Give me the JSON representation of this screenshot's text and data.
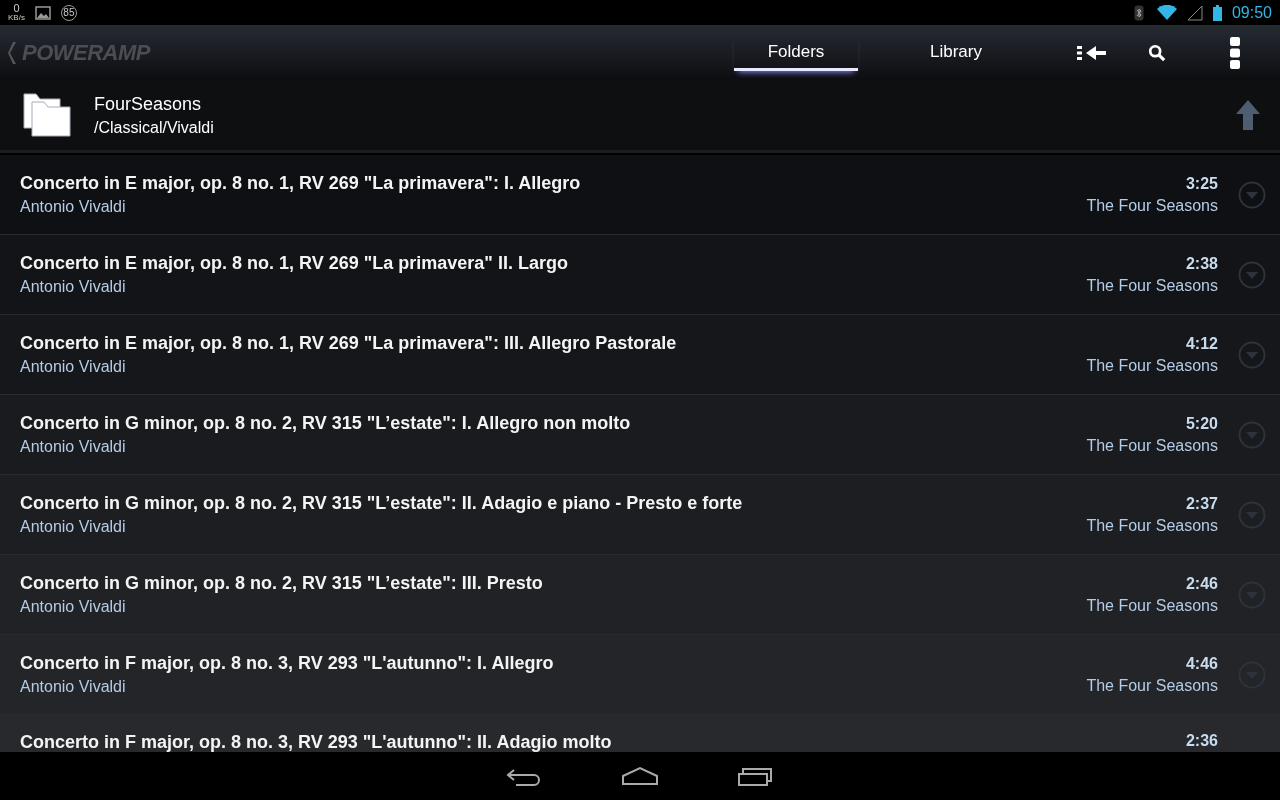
{
  "status_bar": {
    "net_speed": "0",
    "net_unit": "KB/s",
    "badge": "85",
    "time": "09:50"
  },
  "action_bar": {
    "logo": "POWERAMP",
    "tabs": [
      {
        "label": "Folders",
        "selected": true
      },
      {
        "label": "Library",
        "selected": false
      }
    ]
  },
  "folder": {
    "name": "FourSeasons",
    "path": "/Classical/Vivaldi"
  },
  "tracks": [
    {
      "title": "Concerto in E major, op. 8 no. 1, RV 269 \"La primavera\": I. Allegro",
      "artist": "Antonio Vivaldi",
      "duration": "3:25",
      "album": "The Four Seasons"
    },
    {
      "title": "Concerto in E major, op. 8 no. 1, RV 269 \"La primavera\" II. Largo",
      "artist": "Antonio Vivaldi",
      "duration": "2:38",
      "album": "The Four Seasons"
    },
    {
      "title": "Concerto in E major, op. 8 no. 1, RV 269 \"La primavera\": III. Allegro Pastorale",
      "artist": "Antonio Vivaldi",
      "duration": "4:12",
      "album": "The Four Seasons"
    },
    {
      "title": "Concerto in G minor, op. 8 no. 2, RV 315 \"L’estate\": I. Allegro non molto",
      "artist": "Antonio Vivaldi",
      "duration": "5:20",
      "album": "The Four Seasons"
    },
    {
      "title": "Concerto in G minor, op. 8 no. 2, RV 315 \"L’estate\": II. Adagio e piano - Presto e forte",
      "artist": "Antonio Vivaldi",
      "duration": "2:37",
      "album": "The Four Seasons"
    },
    {
      "title": "Concerto in G minor, op. 8 no. 2, RV 315 \"L’estate\": III. Presto",
      "artist": "Antonio Vivaldi",
      "duration": "2:46",
      "album": "The Four Seasons"
    },
    {
      "title": "Concerto in F major, op. 8 no. 3, RV 293 \"L'autunno\": I. Allegro",
      "artist": "Antonio Vivaldi",
      "duration": "4:46",
      "album": "The Four Seasons"
    },
    {
      "title": "Concerto in F major, op. 8 no. 3, RV 293 \"L'autunno\": II. Adagio molto",
      "duration": "2:36"
    }
  ]
}
